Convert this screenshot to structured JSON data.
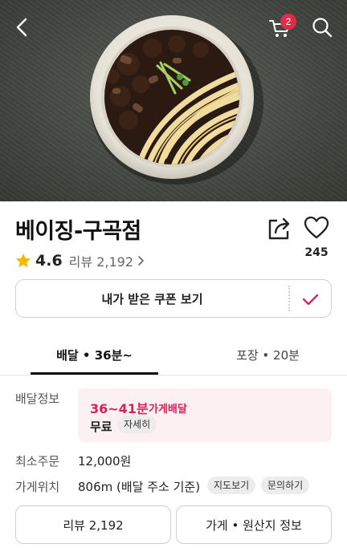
{
  "header": {
    "back_icon": "chevron-left-icon",
    "cart_icon": "cart-icon",
    "cart_count": "2",
    "search_icon": "search-icon"
  },
  "store": {
    "name": "베이징-구곡점",
    "rating": "4.6",
    "review_link": "리뷰 2,192",
    "like_count": "245"
  },
  "coupon": {
    "label": "내가 받은 쿠폰 보기"
  },
  "tabs": [
    {
      "label": "배달 • 36분~",
      "active": true
    },
    {
      "label": "포장 • 20분",
      "active": false
    }
  ],
  "info": {
    "delivery_label": "배달정보",
    "delivery_time": "36~41분",
    "delivery_type": "가게배달",
    "delivery_fee": "무료",
    "detail_chip": "자세히",
    "min_order_label": "최소주문",
    "min_order_value": "12,000원",
    "location_label": "가게위치",
    "location_value": "806m (배달 주소 기준)",
    "map_chip": "지도보기",
    "inquiry_chip": "문의하기"
  },
  "bottom": {
    "reviews_button": "리뷰 2,192",
    "store_info_button": "가게 • 원산지 정보"
  },
  "colors": {
    "accent": "#d72359",
    "badge": "#e02b4a",
    "star": "#f5b800",
    "delivery_bg": "#fdf0f3"
  }
}
